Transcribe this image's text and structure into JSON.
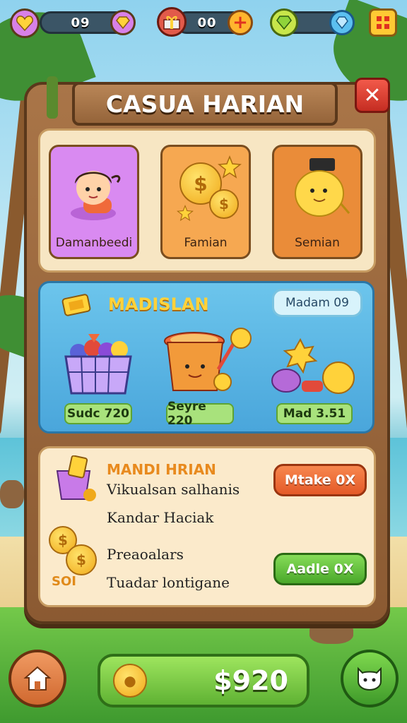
{
  "top_bar": {
    "hearts_value": "09",
    "gifts_value": "00",
    "gems_value": "",
    "plus_icon": "plus-icon",
    "heart_icon": "heart-icon",
    "gift_icon": "gift-icon",
    "gem_icon": "gem-icon",
    "menu_icon": "grid-menu-icon"
  },
  "dialog": {
    "title": "CASUA HARIAN",
    "close_icon": "close-icon"
  },
  "categories": [
    {
      "label": "Damanbeedi",
      "color": "#d98af1"
    },
    {
      "label": "Famian",
      "color": "#f6a851"
    },
    {
      "label": "Semian",
      "color": "#ea8c39"
    }
  ],
  "shop": {
    "title": "MADISLAN",
    "chip": "Madam 09",
    "items": [
      {
        "name": "fruit-basket",
        "price": "Sudc 720"
      },
      {
        "name": "soup-pot",
        "price": "Seyre 220"
      },
      {
        "name": "coin-pile",
        "price": "Mad 3.51"
      }
    ]
  },
  "tasks": {
    "title": "MANDI HRIAN",
    "line1": "Vikualsan salhanis",
    "line2": "Kandar Haciak",
    "line3": "Preaoalars",
    "line4": "Tuadar lontigane",
    "coin_label": "SOI",
    "button1": "Mtake 0X",
    "button2": "Aadle 0X",
    "button1_color": "#f2703e",
    "button2_color": "#63c43b"
  },
  "bottom": {
    "balance": "$920",
    "home_icon": "home-icon",
    "chat_icon": "chat-icon"
  }
}
